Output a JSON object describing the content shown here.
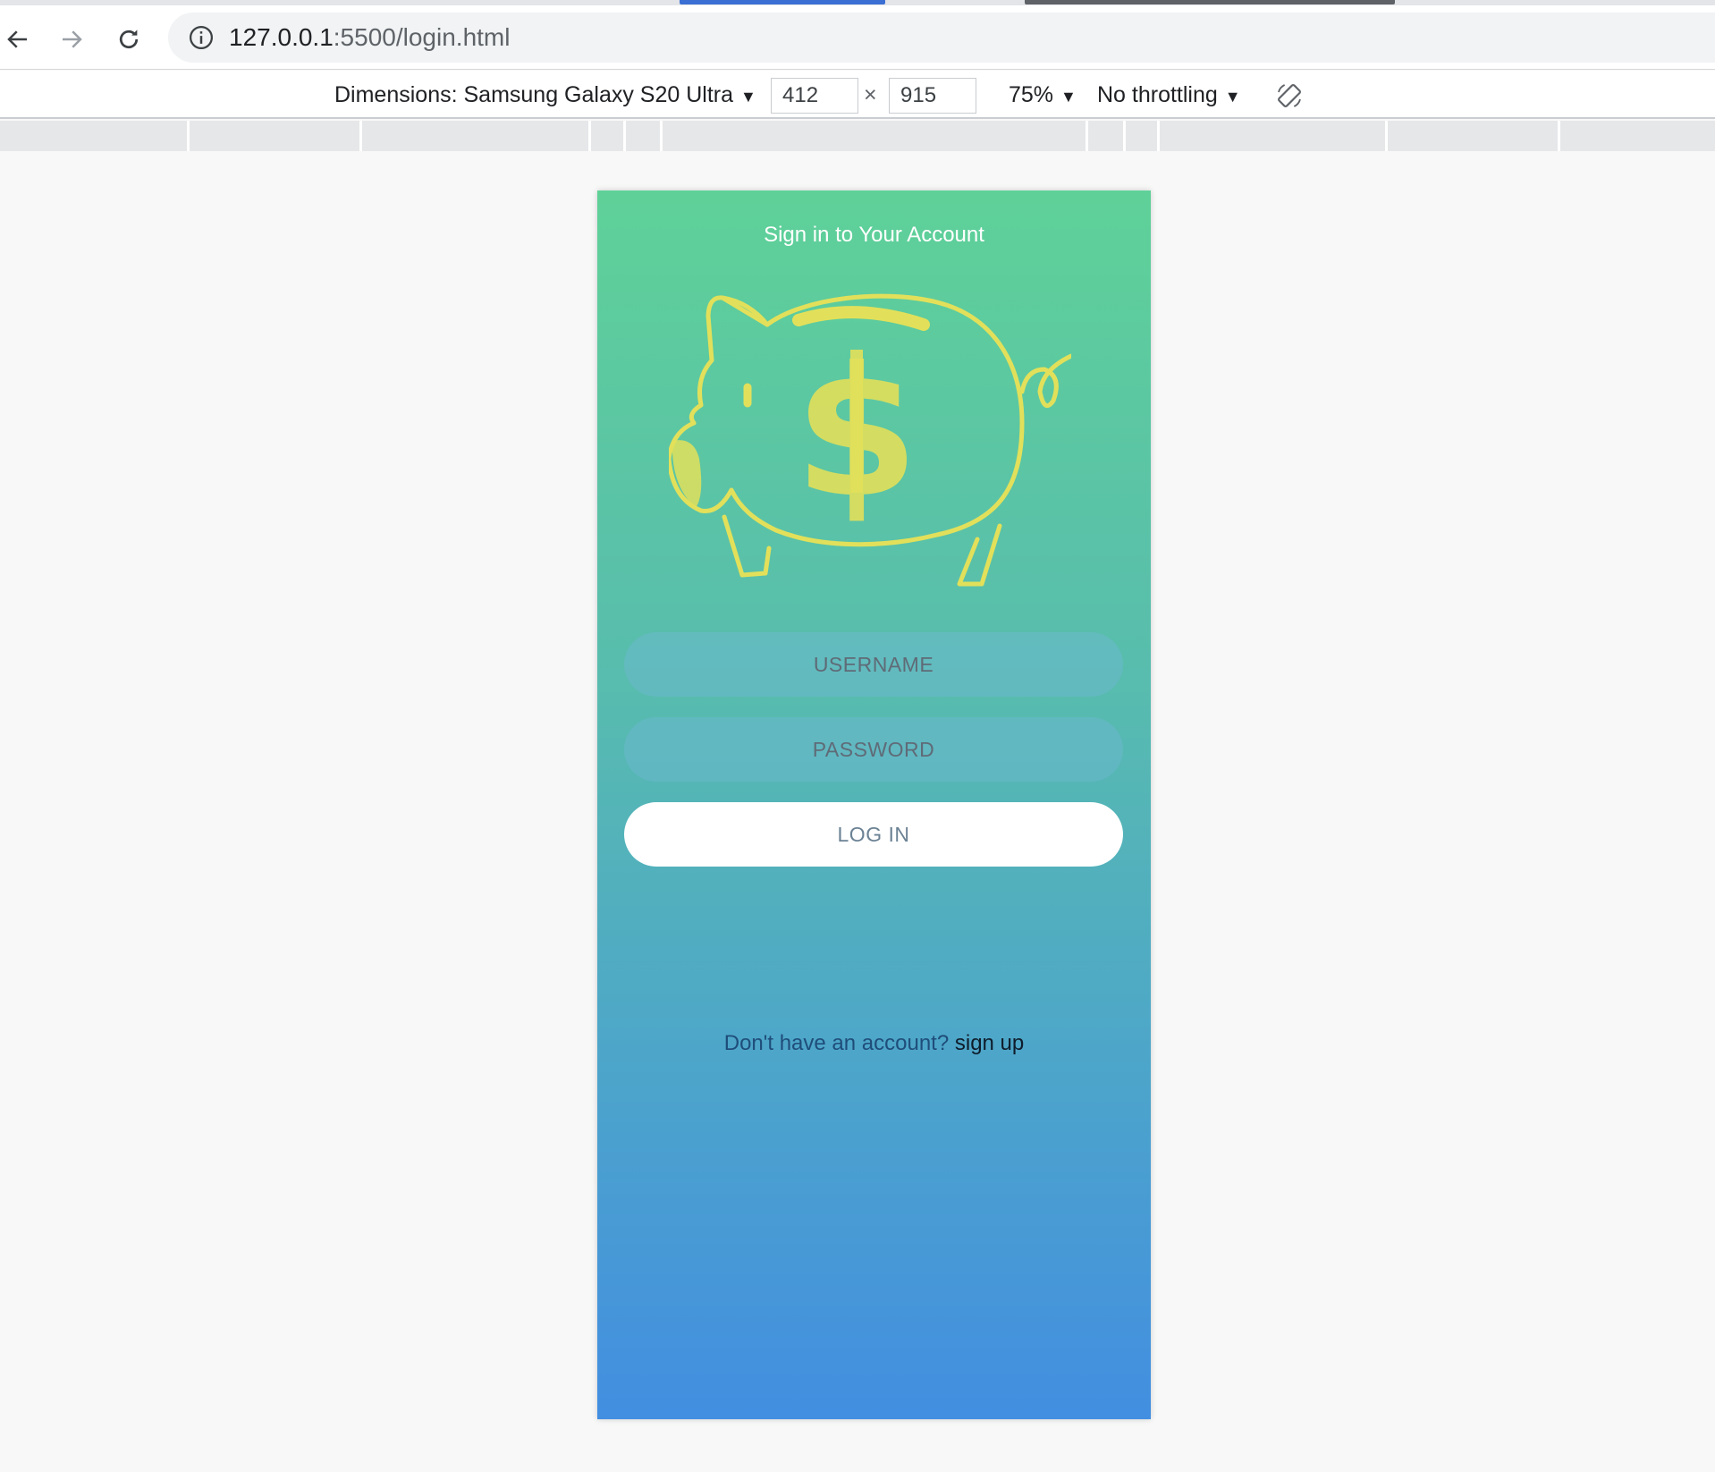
{
  "browser": {
    "url_host": "127.0.0.1",
    "url_rest": ":5500/login.html"
  },
  "device_toolbar": {
    "dimensions_label": "Dimensions: Samsung Galaxy S20 Ultra",
    "width": "412",
    "times": "×",
    "height": "915",
    "zoom": "75%",
    "throttling": "No throttling"
  },
  "login": {
    "title": "Sign in to Your Account",
    "username_placeholder": "USERNAME",
    "password_placeholder": "PASSWORD",
    "login_label": "LOG IN",
    "signup_prompt": "Don't have an account?",
    "signup_link": "sign up"
  },
  "colors": {
    "gradient_top": "#5fd198",
    "gradient_bottom": "#428ee1",
    "illustration": "#e2e05a"
  },
  "icons": {
    "back": "arrow-left-icon",
    "forward": "arrow-right-icon",
    "reload": "reload-icon",
    "site_info": "info-icon",
    "rotate": "rotate-icon",
    "illustration": "piggy-bank-icon"
  }
}
